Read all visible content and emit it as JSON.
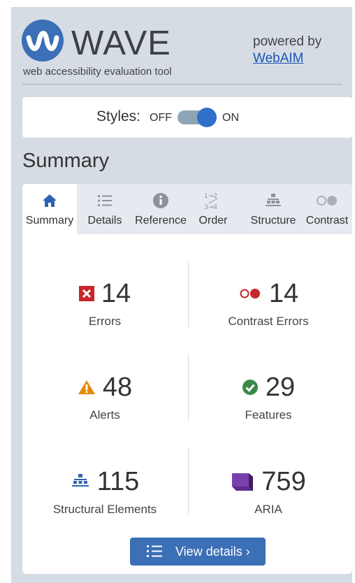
{
  "header": {
    "logo_text": "WAVE",
    "tagline": "web accessibility evaluation tool",
    "powered_by": "powered by",
    "webaim_link": "WebAIM"
  },
  "styles_toggle": {
    "label": "Styles:",
    "off": "OFF",
    "on": "ON",
    "state": "on"
  },
  "summary_heading": "Summary",
  "tabs": [
    {
      "label": "Summary",
      "icon": "home-icon",
      "active": true
    },
    {
      "label": "Details",
      "icon": "list-icon",
      "active": false
    },
    {
      "label": "Reference",
      "icon": "info-icon",
      "active": false
    },
    {
      "label": "Order",
      "icon": "order-icon",
      "active": false
    },
    {
      "label": "Structure",
      "icon": "structure-icon",
      "active": false
    },
    {
      "label": "Contrast",
      "icon": "contrast-icon",
      "active": false
    }
  ],
  "stats": {
    "errors": {
      "value": "14",
      "label": "Errors",
      "icon": "error-icon"
    },
    "contrast_errors": {
      "value": "14",
      "label": "Contrast Errors",
      "icon": "contrast-error-icon"
    },
    "alerts": {
      "value": "48",
      "label": "Alerts",
      "icon": "alert-icon"
    },
    "features": {
      "value": "29",
      "label": "Features",
      "icon": "feature-check-icon"
    },
    "structural": {
      "value": "115",
      "label": "Structural Elements",
      "icon": "structure-icon"
    },
    "aria": {
      "value": "759",
      "label": "ARIA",
      "icon": "aria-icon"
    }
  },
  "view_details_button": "View details ›",
  "colors": {
    "brand_blue": "#3b6fb6",
    "error_red": "#c8262c",
    "alert_orange": "#e18a07",
    "feature_green": "#3a8a4a",
    "aria_purple": "#5f2c8c"
  }
}
